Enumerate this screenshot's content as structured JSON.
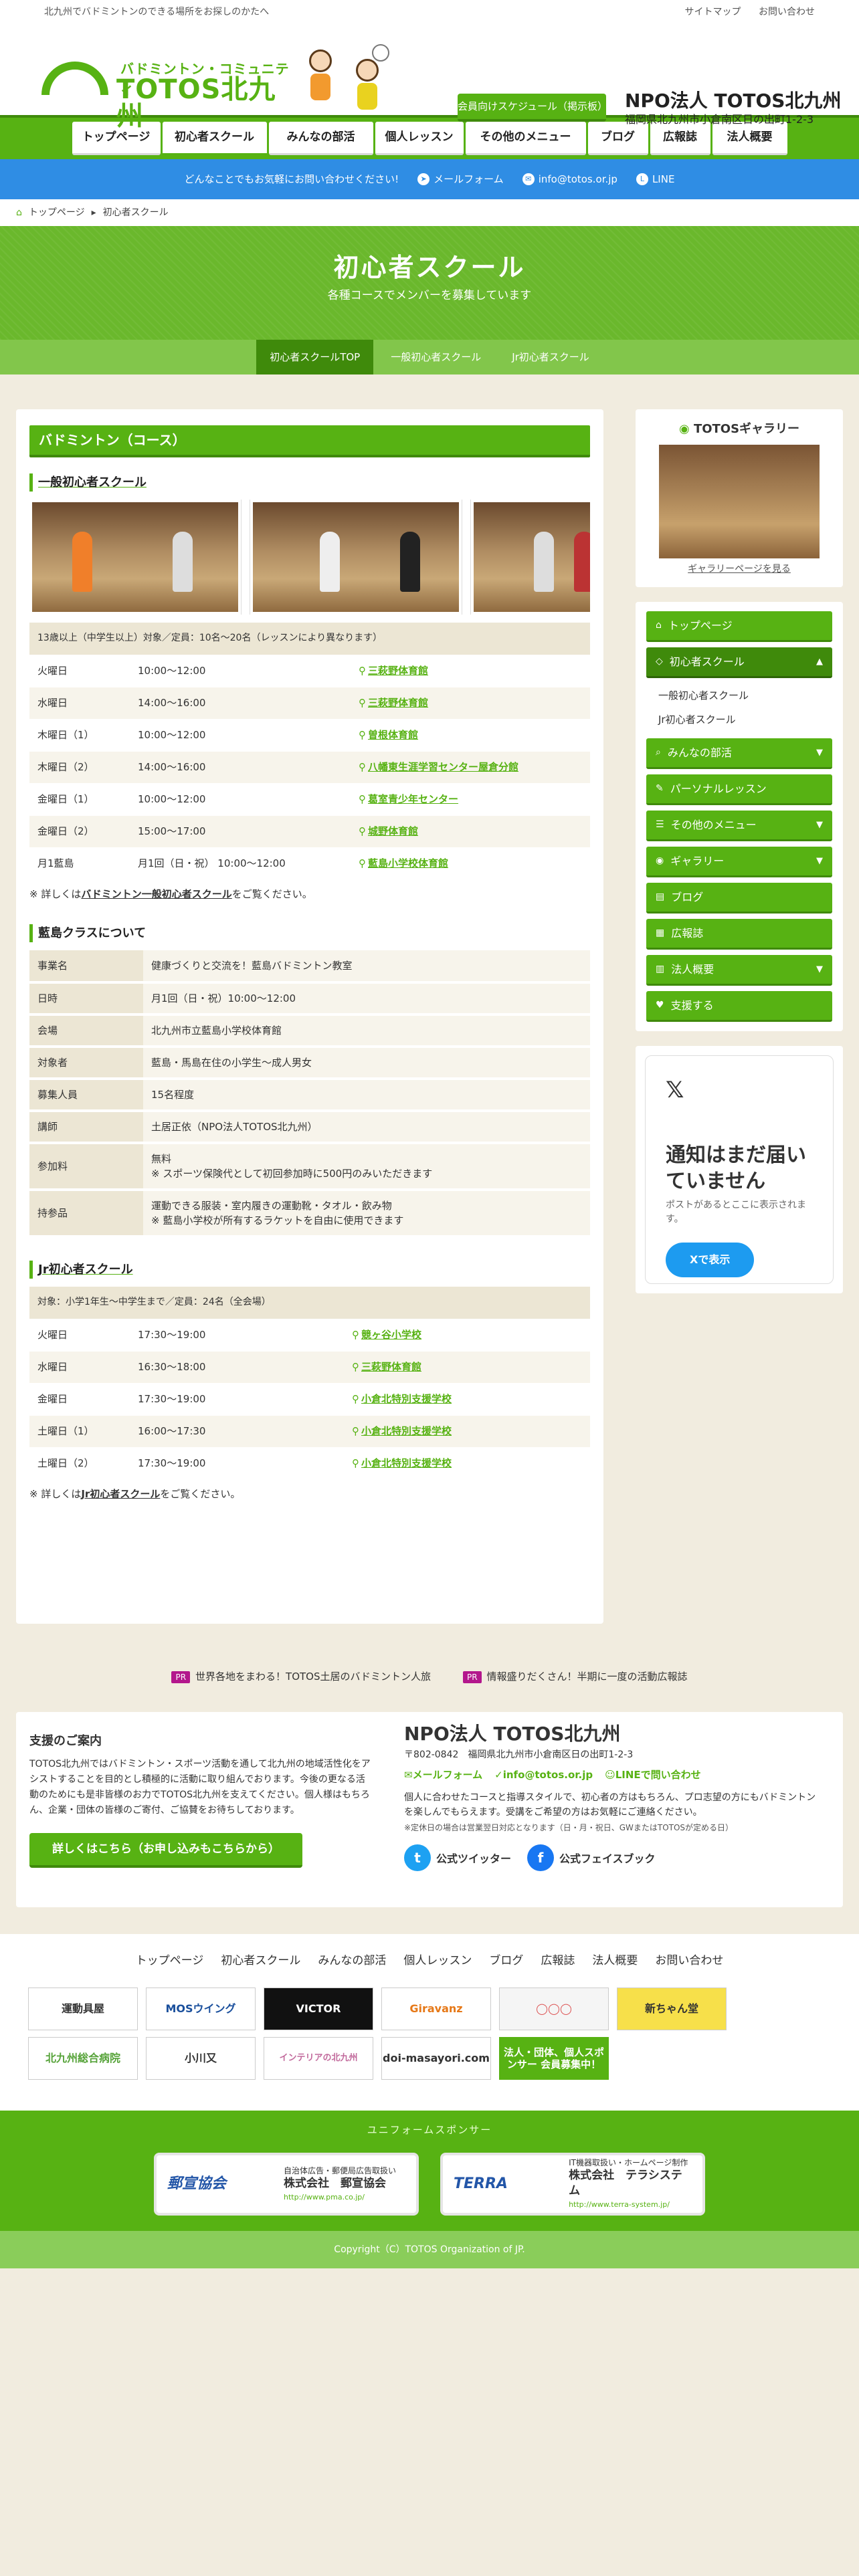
{
  "topbar": {
    "tagline": "北九州でバドミントンのできる場所をお探しのかたへ",
    "links": [
      "サイトマップ",
      "お問い合わせ"
    ]
  },
  "logo": {
    "tagline": "バドミントン・コミュニティ",
    "name": "TOTOS北九州"
  },
  "header": {
    "schedule_button": "会員向けスケジュール（掲示板）",
    "org_name": "NPO法人 TOTOS北九州",
    "org_address": "福岡県北九州市小倉南区日の出町1-2-3"
  },
  "gnav": [
    "トップページ",
    "初心者スクール",
    "みんなの部活",
    "個人レッスン",
    "その他のメニュー",
    "ブログ",
    "広報誌",
    "法人概要"
  ],
  "infobar": {
    "message": "どんなことでもお気軽にお問い合わせください!",
    "mail_form": "メールフォーム",
    "email": "info@totos.or.jp",
    "line": "LINE"
  },
  "breadcrumb": [
    "トップページ",
    "初心者スクール"
  ],
  "hero": {
    "title": "初心者スクール",
    "subtitle": "各種コースでメンバーを募集しています"
  },
  "subnav": [
    "初心者スクールTOP",
    "一般初心者スクール",
    "Jr初心者スクール"
  ],
  "main": {
    "section_title": "バドミントン（コース）",
    "general": {
      "heading": "一般初心者スクール",
      "caption": "13歳以上（中学生以上）対象／定員：10名〜20名（レッスンにより異なります）",
      "rows": [
        {
          "day": "火曜日",
          "time": "10:00〜12:00",
          "place": "三萩野体育館"
        },
        {
          "day": "水曜日",
          "time": "14:00〜16:00",
          "place": "三萩野体育館"
        },
        {
          "day": "木曜日（1）",
          "time": "10:00〜12:00",
          "place": "曽根体育館"
        },
        {
          "day": "木曜日（2）",
          "time": "14:00〜16:00",
          "place": "八幡東生涯学習センター屋倉分館"
        },
        {
          "day": "金曜日（1）",
          "time": "10:00〜12:00",
          "place": "葛室青少年センター"
        },
        {
          "day": "金曜日（2）",
          "time": "15:00〜17:00",
          "place": "城野体育館"
        },
        {
          "day": "月1藍島",
          "time": "月1回（日・祝） 10:00〜12:00",
          "place": "藍島小学校体育館"
        }
      ],
      "note_prefix": "※ 詳しくは",
      "note_link": "バドミントン一般初心者スクール",
      "note_suffix": "をご覧ください。"
    },
    "aishima": {
      "heading": "藍島クラスについて",
      "rows": [
        {
          "k": "事業名",
          "v": "健康づくりと交流を！藍島バドミントン教室"
        },
        {
          "k": "日時",
          "v": "月1回（日・祝）10:00〜12:00"
        },
        {
          "k": "会場",
          "v": "北九州市立藍島小学校体育館"
        },
        {
          "k": "対象者",
          "v": "藍島・馬島在住の小学生〜成人男女"
        },
        {
          "k": "募集人員",
          "v": "15名程度"
        },
        {
          "k": "講師",
          "v": "土居正依（NPO法人TOTOS北九州）"
        },
        {
          "k": "参加料",
          "v": "無料",
          "v2": "※ スポーツ保険代として初回参加時に500円のみいただきます"
        },
        {
          "k": "持参品",
          "v": "運動できる服装・室内履きの運動靴・タオル・飲み物",
          "v2": "※ 藍島小学校が所有するラケットを自由に使用できます"
        }
      ]
    },
    "junior": {
      "heading": "Jr初心者スクール",
      "caption": "対象：小学1年生〜中学生まで／定員：24名（全会場）",
      "rows": [
        {
          "day": "火曜日",
          "time": "17:30〜19:00",
          "place": "競ヶ谷小学校"
        },
        {
          "day": "水曜日",
          "time": "16:30〜18:00",
          "place": "三萩野体育館"
        },
        {
          "day": "金曜日",
          "time": "17:30〜19:00",
          "place": "小倉北特別支援学校"
        },
        {
          "day": "土曜日（1）",
          "time": "16:00〜17:30",
          "place": "小倉北特別支援学校"
        },
        {
          "day": "土曜日（2）",
          "time": "17:30〜19:00",
          "place": "小倉北特別支援学校"
        }
      ],
      "note_prefix": "※ 詳しくは",
      "note_link": "Jr初心者スクール",
      "note_suffix": "をご覧ください。"
    }
  },
  "sidebar": {
    "gallery_title": "TOTOSギャラリー",
    "gallery_link": "ギャラリーページを見る",
    "menu": [
      {
        "label": "トップページ",
        "icon": "home-icon"
      },
      {
        "label": "初心者スクール",
        "icon": "tag-icon",
        "open": true
      },
      {
        "label": "みんなの部活",
        "icon": "search-icon"
      },
      {
        "label": "パーソナルレッスン",
        "icon": "pencil-icon"
      },
      {
        "label": "その他のメニュー",
        "icon": "list-icon"
      },
      {
        "label": "ギャラリー",
        "icon": "camera-icon"
      },
      {
        "label": "ブログ",
        "icon": "note-icon"
      },
      {
        "label": "広報誌",
        "icon": "doc-icon"
      },
      {
        "label": "法人概要",
        "icon": "building-icon"
      },
      {
        "label": "支援する",
        "icon": "heart-icon"
      }
    ],
    "submenu": [
      "一般初心者スクール",
      "Jr初心者スクール"
    ],
    "x_widget": {
      "title": "通知はまだ届いていません",
      "subtitle": "ポストがあるとここに表示されます。",
      "button": "Xで表示"
    }
  },
  "pr": [
    {
      "tag": "PR",
      "text": "世界各地をまわる！TOTOS土居のバドミントン人旅"
    },
    {
      "tag": "PR",
      "text": "情報盛りだくさん！半期に一度の活動広報誌"
    }
  ],
  "support": {
    "title": "支援のご案内",
    "body": "TOTOS北九州ではバドミントン・スポーツ活動を通して北九州の地域活性化をアシストすることを目的とし積極的に活動に取り組んでおります。今後の更なる活動のためにも是非皆様のお力でTOTOS北九州を支えてください。個人様はもちろん、企業・団体の皆様のご寄付、ご協賛をお待ちしております。",
    "button": "詳しくはこちら（お申し込みもこちらから）"
  },
  "org": {
    "name": "NPO法人 TOTOS北九州",
    "address": "〒802-0842　福岡県北九州市小倉南区日の出町1-2-3",
    "contacts": [
      "メールフォーム",
      "info@totos.or.jp",
      "LINEで問い合わせ"
    ],
    "desc": "個人に合わせたコースと指導スタイルで、初心者の方はもちろん、プロ志望の方にもバドミントンを楽しんでもらえます。受講をご希望の方はお気軽にご連絡ください。",
    "small": "※定休日の場合は営業翌日対応となります（日・月・祝日、GWまたはTOTOSが定める日）",
    "twitter": "公式ツイッター",
    "facebook": "公式フェイスブック"
  },
  "footer_nav": [
    "トップページ",
    "初心者スクール",
    "みんなの部活",
    "個人レッスン",
    "ブログ",
    "広報誌",
    "法人概要",
    "お問い合わせ"
  ],
  "sponsors": [
    "運動具屋",
    "MOSウイング",
    "VICTOR",
    "Giravanz",
    "新ちゃん堂",
    "北九州総合病院",
    "小川又",
    "インテリアの北九州",
    "doi-masayori.com",
    "法人・団体、個人スポンサー 会員募集中！"
  ],
  "uniform": {
    "title": "ユニフォームスポンサー",
    "cards": [
      {
        "logo": "郵宣協会",
        "desc": "自治体広告・郵便局広告取扱い",
        "company": "株式会社　郵宣協会",
        "url": "http://www.pma.co.jp/"
      },
      {
        "logo": "TERRA",
        "desc": "IT機器取扱い・ホームページ制作",
        "company": "株式会社　テラシステム",
        "url": "http://www.terra-system.jp/"
      }
    ]
  },
  "copyright": "Copyright（C）TOTOS Organization of JP."
}
